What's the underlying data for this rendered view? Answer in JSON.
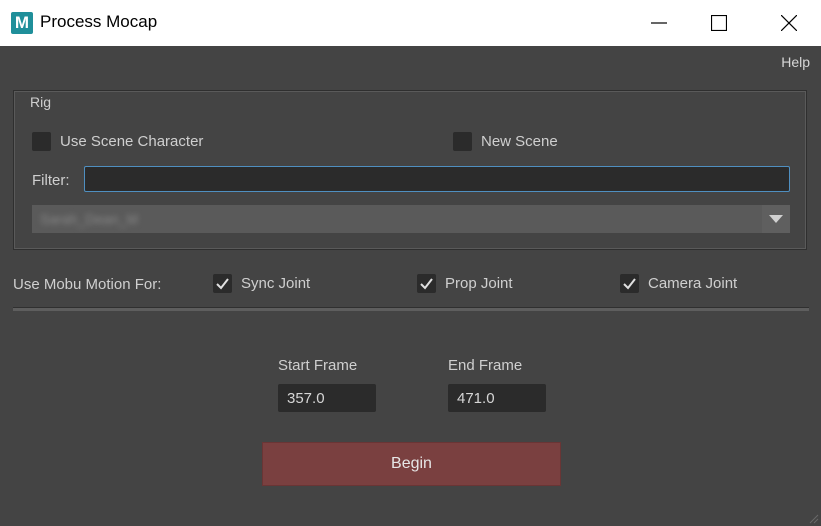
{
  "window": {
    "app_icon_letter": "M",
    "title": "Process Mocap"
  },
  "menubar": {
    "help_label": "Help"
  },
  "rig_group": {
    "title": "Rig",
    "use_scene_character": {
      "label": "Use Scene Character",
      "checked": false
    },
    "new_scene": {
      "label": "New Scene",
      "checked": false
    },
    "filter_label": "Filter:",
    "filter_value": "",
    "dropdown_selected": "Sarah_Dean_M"
  },
  "mobu_motion": {
    "label": "Use Mobu Motion For:",
    "options": [
      {
        "label": "Sync Joint",
        "checked": true
      },
      {
        "label": "Prop Joint",
        "checked": true
      },
      {
        "label": "Camera Joint",
        "checked": true
      }
    ]
  },
  "frames": {
    "start_label": "Start Frame",
    "start_value": "357.0",
    "end_label": "End Frame",
    "end_value": "471.0"
  },
  "begin_button_label": "Begin",
  "colors": {
    "background": "#444444",
    "begin_button": "#7a4040",
    "field_background": "#2b2b2b",
    "focus_border": "#4f8fc0"
  }
}
